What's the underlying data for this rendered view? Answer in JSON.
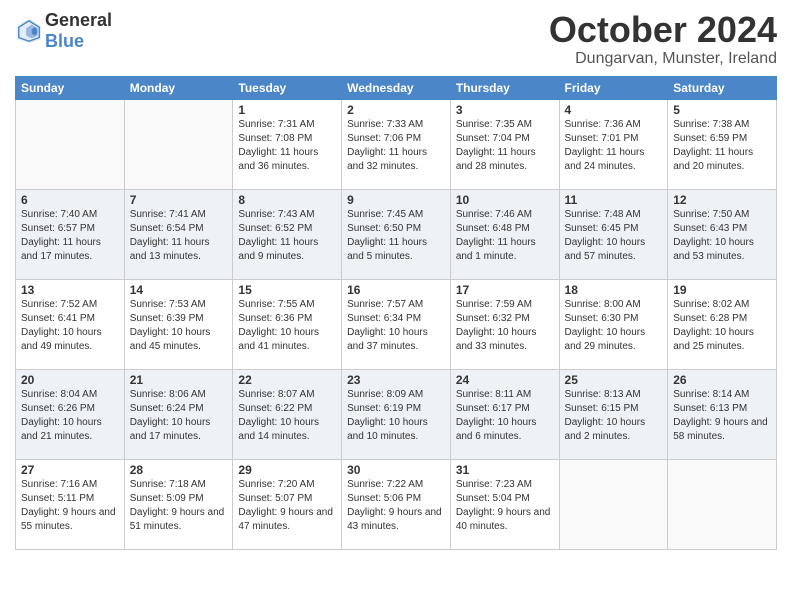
{
  "header": {
    "logo_general": "General",
    "logo_blue": "Blue",
    "month_title": "October 2024",
    "location": "Dungarvan, Munster, Ireland"
  },
  "weekdays": [
    "Sunday",
    "Monday",
    "Tuesday",
    "Wednesday",
    "Thursday",
    "Friday",
    "Saturday"
  ],
  "weeks": [
    [
      {
        "day": "",
        "sunrise": "",
        "sunset": "",
        "daylight": ""
      },
      {
        "day": "",
        "sunrise": "",
        "sunset": "",
        "daylight": ""
      },
      {
        "day": "1",
        "sunrise": "Sunrise: 7:31 AM",
        "sunset": "Sunset: 7:08 PM",
        "daylight": "Daylight: 11 hours and 36 minutes."
      },
      {
        "day": "2",
        "sunrise": "Sunrise: 7:33 AM",
        "sunset": "Sunset: 7:06 PM",
        "daylight": "Daylight: 11 hours and 32 minutes."
      },
      {
        "day": "3",
        "sunrise": "Sunrise: 7:35 AM",
        "sunset": "Sunset: 7:04 PM",
        "daylight": "Daylight: 11 hours and 28 minutes."
      },
      {
        "day": "4",
        "sunrise": "Sunrise: 7:36 AM",
        "sunset": "Sunset: 7:01 PM",
        "daylight": "Daylight: 11 hours and 24 minutes."
      },
      {
        "day": "5",
        "sunrise": "Sunrise: 7:38 AM",
        "sunset": "Sunset: 6:59 PM",
        "daylight": "Daylight: 11 hours and 20 minutes."
      }
    ],
    [
      {
        "day": "6",
        "sunrise": "Sunrise: 7:40 AM",
        "sunset": "Sunset: 6:57 PM",
        "daylight": "Daylight: 11 hours and 17 minutes."
      },
      {
        "day": "7",
        "sunrise": "Sunrise: 7:41 AM",
        "sunset": "Sunset: 6:54 PM",
        "daylight": "Daylight: 11 hours and 13 minutes."
      },
      {
        "day": "8",
        "sunrise": "Sunrise: 7:43 AM",
        "sunset": "Sunset: 6:52 PM",
        "daylight": "Daylight: 11 hours and 9 minutes."
      },
      {
        "day": "9",
        "sunrise": "Sunrise: 7:45 AM",
        "sunset": "Sunset: 6:50 PM",
        "daylight": "Daylight: 11 hours and 5 minutes."
      },
      {
        "day": "10",
        "sunrise": "Sunrise: 7:46 AM",
        "sunset": "Sunset: 6:48 PM",
        "daylight": "Daylight: 11 hours and 1 minute."
      },
      {
        "day": "11",
        "sunrise": "Sunrise: 7:48 AM",
        "sunset": "Sunset: 6:45 PM",
        "daylight": "Daylight: 10 hours and 57 minutes."
      },
      {
        "day": "12",
        "sunrise": "Sunrise: 7:50 AM",
        "sunset": "Sunset: 6:43 PM",
        "daylight": "Daylight: 10 hours and 53 minutes."
      }
    ],
    [
      {
        "day": "13",
        "sunrise": "Sunrise: 7:52 AM",
        "sunset": "Sunset: 6:41 PM",
        "daylight": "Daylight: 10 hours and 49 minutes."
      },
      {
        "day": "14",
        "sunrise": "Sunrise: 7:53 AM",
        "sunset": "Sunset: 6:39 PM",
        "daylight": "Daylight: 10 hours and 45 minutes."
      },
      {
        "day": "15",
        "sunrise": "Sunrise: 7:55 AM",
        "sunset": "Sunset: 6:36 PM",
        "daylight": "Daylight: 10 hours and 41 minutes."
      },
      {
        "day": "16",
        "sunrise": "Sunrise: 7:57 AM",
        "sunset": "Sunset: 6:34 PM",
        "daylight": "Daylight: 10 hours and 37 minutes."
      },
      {
        "day": "17",
        "sunrise": "Sunrise: 7:59 AM",
        "sunset": "Sunset: 6:32 PM",
        "daylight": "Daylight: 10 hours and 33 minutes."
      },
      {
        "day": "18",
        "sunrise": "Sunrise: 8:00 AM",
        "sunset": "Sunset: 6:30 PM",
        "daylight": "Daylight: 10 hours and 29 minutes."
      },
      {
        "day": "19",
        "sunrise": "Sunrise: 8:02 AM",
        "sunset": "Sunset: 6:28 PM",
        "daylight": "Daylight: 10 hours and 25 minutes."
      }
    ],
    [
      {
        "day": "20",
        "sunrise": "Sunrise: 8:04 AM",
        "sunset": "Sunset: 6:26 PM",
        "daylight": "Daylight: 10 hours and 21 minutes."
      },
      {
        "day": "21",
        "sunrise": "Sunrise: 8:06 AM",
        "sunset": "Sunset: 6:24 PM",
        "daylight": "Daylight: 10 hours and 17 minutes."
      },
      {
        "day": "22",
        "sunrise": "Sunrise: 8:07 AM",
        "sunset": "Sunset: 6:22 PM",
        "daylight": "Daylight: 10 hours and 14 minutes."
      },
      {
        "day": "23",
        "sunrise": "Sunrise: 8:09 AM",
        "sunset": "Sunset: 6:19 PM",
        "daylight": "Daylight: 10 hours and 10 minutes."
      },
      {
        "day": "24",
        "sunrise": "Sunrise: 8:11 AM",
        "sunset": "Sunset: 6:17 PM",
        "daylight": "Daylight: 10 hours and 6 minutes."
      },
      {
        "day": "25",
        "sunrise": "Sunrise: 8:13 AM",
        "sunset": "Sunset: 6:15 PM",
        "daylight": "Daylight: 10 hours and 2 minutes."
      },
      {
        "day": "26",
        "sunrise": "Sunrise: 8:14 AM",
        "sunset": "Sunset: 6:13 PM",
        "daylight": "Daylight: 9 hours and 58 minutes."
      }
    ],
    [
      {
        "day": "27",
        "sunrise": "Sunrise: 7:16 AM",
        "sunset": "Sunset: 5:11 PM",
        "daylight": "Daylight: 9 hours and 55 minutes."
      },
      {
        "day": "28",
        "sunrise": "Sunrise: 7:18 AM",
        "sunset": "Sunset: 5:09 PM",
        "daylight": "Daylight: 9 hours and 51 minutes."
      },
      {
        "day": "29",
        "sunrise": "Sunrise: 7:20 AM",
        "sunset": "Sunset: 5:07 PM",
        "daylight": "Daylight: 9 hours and 47 minutes."
      },
      {
        "day": "30",
        "sunrise": "Sunrise: 7:22 AM",
        "sunset": "Sunset: 5:06 PM",
        "daylight": "Daylight: 9 hours and 43 minutes."
      },
      {
        "day": "31",
        "sunrise": "Sunrise: 7:23 AM",
        "sunset": "Sunset: 5:04 PM",
        "daylight": "Daylight: 9 hours and 40 minutes."
      },
      {
        "day": "",
        "sunrise": "",
        "sunset": "",
        "daylight": ""
      },
      {
        "day": "",
        "sunrise": "",
        "sunset": "",
        "daylight": ""
      }
    ]
  ]
}
